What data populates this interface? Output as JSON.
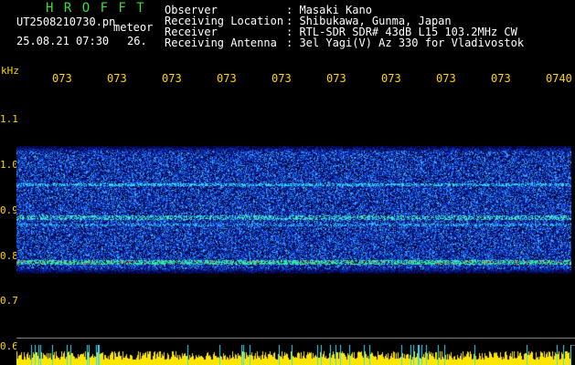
{
  "header": {
    "logo": "H R O F F T",
    "filename": "UT2508210730.pn",
    "filename_suffix": "meteor",
    "datetime": "25.08.21 07:30",
    "count": "26."
  },
  "info": [
    {
      "label": "Observer",
      "value": ": Masaki Kano"
    },
    {
      "label": "Receiving Location",
      "value": ": Shibukawa, Gunma, Japan"
    },
    {
      "label": "Receiver",
      "value": ": RTL-SDR SDR# 43dB L15 103.2MHz CW"
    },
    {
      "label": "Receiving Antenna",
      "value": ": 3el Yagi(V) Az 330 for Vladivostok"
    }
  ],
  "y_axis": {
    "unit": "kHz",
    "ticks": [
      "1.1",
      "1.0",
      "0.9",
      "0.8",
      "0.7",
      "0.6"
    ]
  },
  "x_axis": {
    "ticks": [
      "073",
      "073",
      "073",
      "073",
      "073",
      "073",
      "073",
      "073",
      "073",
      "0740"
    ]
  },
  "colors": {
    "background": "#000000",
    "header_green": "#3fdc3f",
    "tick_yellow": "#ffd400",
    "text_white": "#ffffff",
    "noise_blue": "#1a3cff",
    "signal_cyan": "#30e0ff",
    "echo_red": "#ff3030",
    "meter_yellow": "#ffe600"
  }
}
